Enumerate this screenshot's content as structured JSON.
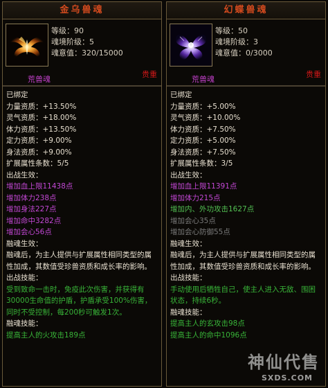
{
  "left": {
    "title": "金乌兽魂",
    "level": "等级：90",
    "realm": "魂境阶级：5",
    "soul_power": "魂意值：320/15000",
    "type": "荒兽魂",
    "rarity": "贵重",
    "lines": [
      {
        "t": "已绑定",
        "c": ""
      },
      {
        "t": "力量资质：+13.50%",
        "c": ""
      },
      {
        "t": "灵气资质：+18.00%",
        "c": ""
      },
      {
        "t": "体力资质：+13.50%",
        "c": ""
      },
      {
        "t": "定力资质：+9.00%",
        "c": ""
      },
      {
        "t": "身法资质：+9.00%",
        "c": ""
      },
      {
        "t": "扩展属性条数：5/5",
        "c": ""
      },
      {
        "t": "出战生效：",
        "c": ""
      },
      {
        "t": "增加血上限11438点",
        "c": "purple"
      },
      {
        "t": "增加体力238点",
        "c": "purple"
      },
      {
        "t": "增加身法227点",
        "c": "purple"
      },
      {
        "t": "增加命中3282点",
        "c": "purple"
      },
      {
        "t": "增加会心56点",
        "c": "purple"
      },
      {
        "t": "融魂生效：",
        "c": ""
      }
    ],
    "fuse_desc": "融魂后，为主人提供与扩展属性相同类型的属性加成，其数值受珍兽资质和成长率的影响。",
    "battle_skill_header": "出战技能：",
    "battle_skill_desc": "受到致命一击时，免疫此次伤害，并获得有30000生命值的护盾，护盾承受100%伤害，同时不受控制，每200秒可触发1次。",
    "fuse_skill_header": "融魂技能：",
    "fuse_skill_desc": "提高主人的火攻击189点"
  },
  "right": {
    "title": "幻蝶兽魂",
    "level": "等级：50",
    "realm": "魂境阶级：3",
    "soul_power": "魂意值：0/3000",
    "type": "荒兽魂",
    "rarity": "贵重",
    "lines": [
      {
        "t": "已绑定",
        "c": ""
      },
      {
        "t": "力量资质：+5.00%",
        "c": ""
      },
      {
        "t": "灵气资质：+10.00%",
        "c": ""
      },
      {
        "t": "体力资质：+7.50%",
        "c": ""
      },
      {
        "t": "定力资质：+5.00%",
        "c": ""
      },
      {
        "t": "身法资质：+7.50%",
        "c": ""
      },
      {
        "t": "扩展属性条数：3/5",
        "c": ""
      },
      {
        "t": "出战生效：",
        "c": ""
      },
      {
        "t": "增加血上限11391点",
        "c": "purple"
      },
      {
        "t": "增加体力215点",
        "c": "purple"
      },
      {
        "t": "增加内、外功攻击1627点",
        "c": "lgreen"
      },
      {
        "t": "增加会心35点",
        "c": "gray"
      },
      {
        "t": "增加会心防御55点",
        "c": "gray"
      },
      {
        "t": "融魂生效：",
        "c": ""
      }
    ],
    "fuse_desc": "融魂后，为主人提供与扩展属性相同类型的属性加成，其数值受珍兽资质和成长率的影响。",
    "battle_skill_header": "出战技能：",
    "battle_skill_desc": "手动使用后牺牲自己，使主人进入无敌、围困状态，持续6秒。",
    "fuse_skill_header": "融魂技能：",
    "fuse_skill_desc1": "提高主人的玄攻击98点",
    "fuse_skill_desc2": "提高主人的命中1096点"
  },
  "watermark": {
    "text": "神仙代售",
    "url": "SXDS.COM"
  }
}
